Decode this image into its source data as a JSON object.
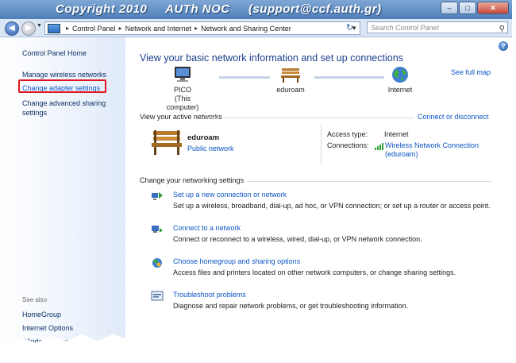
{
  "banner": "Copyright 2010     AUTh NOC     (support@ccf.auth.gr)",
  "address": {
    "crumbs": [
      "Control Panel",
      "Network and Internet",
      "Network and Sharing Center"
    ],
    "search_placeholder": "Search Control Panel"
  },
  "sidebar": {
    "home": "Control Panel Home",
    "items": [
      "Manage wireless networks",
      "Change adapter settings",
      "Change advanced sharing settings"
    ],
    "see_also": "See also",
    "links": [
      "HomeGroup",
      "Internet Options",
      "Windows Firewall"
    ]
  },
  "main": {
    "heading": "View your basic network information and set up connections",
    "see_full_map": "See full map",
    "nodes": {
      "pc_name": "PICO",
      "pc_sub": "(This computer)",
      "network": "eduroam",
      "internet": "Internet"
    },
    "active_title": "View your active networks",
    "connect": "Connect or disconnect",
    "network_name": "eduroam",
    "network_type": "Public network",
    "access_label": "Access type:",
    "access_value": "Internet",
    "connections_label": "Connections:",
    "connection_link": "Wireless Network Connection",
    "connection_sub": "(eduroam)",
    "change_title": "Change your networking settings",
    "tasks": [
      {
        "link": "Set up a new connection or network",
        "desc": "Set up a wireless, broadband, dial-up, ad hoc, or VPN connection; or set up a router or access point."
      },
      {
        "link": "Connect to a network",
        "desc": "Connect or reconnect to a wireless, wired, dial-up, or VPN network connection."
      },
      {
        "link": "Choose homegroup and sharing options",
        "desc": "Access files and printers located on other network computers, or change sharing settings."
      },
      {
        "link": "Troubleshoot problems",
        "desc": "Diagnose and repair network problems, or get troubleshooting information."
      }
    ]
  },
  "colors": {
    "link": "#0b55c4",
    "heading": "#1a3e8c",
    "highlight": "#e0141e",
    "banner_bg": "#4f7fb8"
  }
}
